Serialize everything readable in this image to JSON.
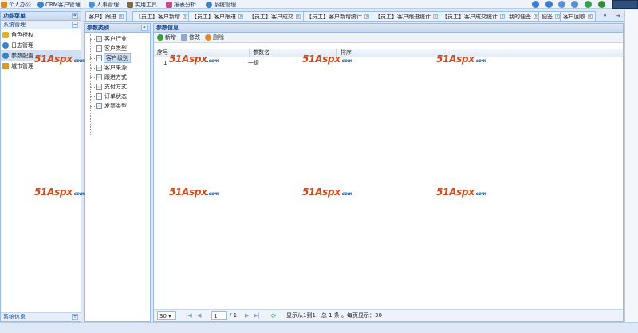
{
  "topnav": {
    "items": [
      {
        "label": "个人办公",
        "icon": "person-icon",
        "color": "#e08a1e"
      },
      {
        "label": "CRM客户管理",
        "icon": "globe-icon",
        "color": "#3b82c4"
      },
      {
        "label": "人事管理",
        "icon": "people-icon",
        "color": "#4a90d9"
      },
      {
        "label": "实用工具",
        "icon": "toolbox-icon",
        "color": "#7a6a4a"
      },
      {
        "label": "报表分析",
        "icon": "chart-icon",
        "color": "#c84a8c"
      },
      {
        "label": "系统管理",
        "icon": "gear-icon",
        "color": "#3b82c4"
      }
    ],
    "tool_icons": [
      {
        "name": "home-icon",
        "color": "#3b7bd0"
      },
      {
        "name": "user-icon",
        "color": "#3b7bd0"
      },
      {
        "name": "lock-icon",
        "color": "#5b8fcf"
      },
      {
        "name": "help-icon",
        "color": "#5b8fcf"
      },
      {
        "name": "refresh-icon",
        "color": "#33a24a"
      },
      {
        "name": "exit-icon",
        "color": "#2f8f2f"
      }
    ]
  },
  "left": {
    "title": "功能菜单",
    "group": "系统管理",
    "items": [
      {
        "label": "角色授权",
        "icon": "key-icon",
        "color": "#e0b02a"
      },
      {
        "label": "日志管理",
        "icon": "globe-icon",
        "color": "#3b82c4"
      },
      {
        "label": "参数配置",
        "icon": "globe-icon",
        "color": "#3b82c4"
      },
      {
        "label": "城市管理",
        "icon": "home-icon",
        "color": "#d89a2a"
      }
    ],
    "footer": "系统信息"
  },
  "tabs": [
    {
      "label": "客户】跟进"
    },
    {
      "label": "【员工】客户新增"
    },
    {
      "label": "【员工】客户跟进"
    },
    {
      "label": "【员工】客户成交"
    },
    {
      "label": "【员工】客户新增统计"
    },
    {
      "label": "【员工】客户跟进统计"
    },
    {
      "label": "【员工】客户成交统计"
    },
    {
      "label": "我的便签"
    },
    {
      "label": "便签"
    },
    {
      "label": "客户回收"
    }
  ],
  "category": {
    "title": "参数类别",
    "items": [
      "客户行业",
      "客户类型",
      "客户级别",
      "客户来源",
      "跟进方式",
      "支付方式",
      "订单状态",
      "发票类型"
    ]
  },
  "info": {
    "title": "参数信息",
    "toolbar": {
      "add": "新增",
      "edit": "修改",
      "delete": "删除"
    },
    "columns": [
      "序号",
      "参数名",
      "排序"
    ],
    "rows": [
      {
        "index": "1",
        "name": "一级",
        "sort": ""
      }
    ]
  },
  "pager": {
    "page_size": "30",
    "page": "1",
    "total_pages": "/ 1",
    "summary": "显示从1到1，总 1 条 。每页显示：30"
  },
  "watermark": {
    "main": "51Aspx",
    "suffix": ".com"
  },
  "colors": {
    "accent": "#15428b",
    "border": "#99bbe8",
    "selected": "#cfe0f5"
  }
}
